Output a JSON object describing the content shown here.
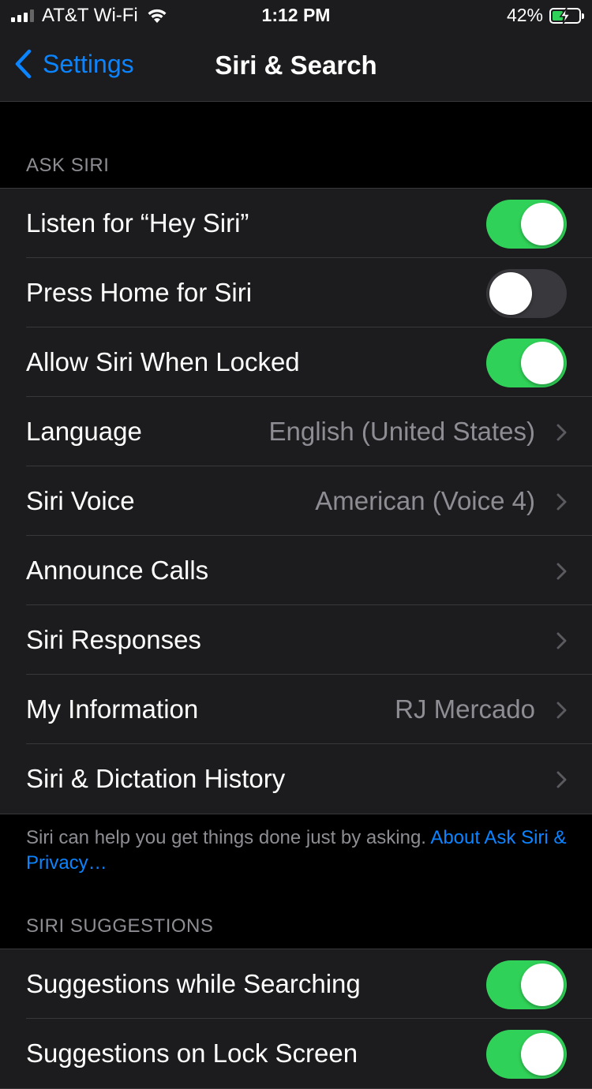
{
  "status_bar": {
    "carrier": "AT&T Wi-Fi",
    "time": "1:12 PM",
    "battery_percent": "42%",
    "battery_level": 0.42,
    "icons": [
      "signal-icon",
      "wifi-icon",
      "battery-charging-icon"
    ]
  },
  "nav": {
    "back_label": "Settings",
    "title": "Siri & Search"
  },
  "ask_siri": {
    "header": "ASK SIRI",
    "rows": [
      {
        "label": "Listen for “Hey Siri”",
        "type": "toggle",
        "on": true
      },
      {
        "label": "Press Home for Siri",
        "type": "toggle",
        "on": false
      },
      {
        "label": "Allow Siri When Locked",
        "type": "toggle",
        "on": true
      },
      {
        "label": "Language",
        "type": "link",
        "value": "English (United States)"
      },
      {
        "label": "Siri Voice",
        "type": "link",
        "value": "American (Voice 4)"
      },
      {
        "label": "Announce Calls",
        "type": "link",
        "value": ""
      },
      {
        "label": "Siri Responses",
        "type": "link",
        "value": ""
      },
      {
        "label": "My Information",
        "type": "link",
        "value": "RJ Mercado"
      },
      {
        "label": "Siri & Dictation History",
        "type": "link",
        "value": ""
      }
    ],
    "footer_text": "Siri can help you get things done just by asking. ",
    "footer_link": "About Ask Siri & Privacy…"
  },
  "siri_suggestions": {
    "header": "SIRI SUGGESTIONS",
    "rows": [
      {
        "label": "Suggestions while Searching",
        "type": "toggle",
        "on": true
      },
      {
        "label": "Suggestions on Lock Screen",
        "type": "toggle",
        "on": true
      }
    ]
  },
  "colors": {
    "accent": "#0a84ff",
    "toggle_on": "#30d158",
    "toggle_off": "#39393d",
    "background": "#000000",
    "cell": "#1c1c1e"
  }
}
